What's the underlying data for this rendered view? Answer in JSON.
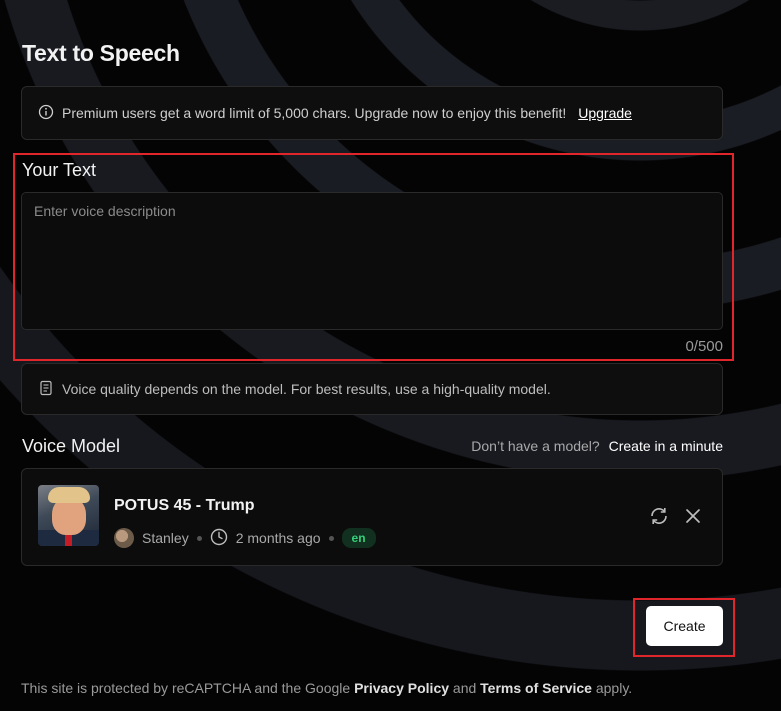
{
  "page": {
    "title": "Text to Speech"
  },
  "notice": {
    "icon": "info-icon",
    "message": "Premium users get a word limit of 5,000 chars. Upgrade now to enjoy this benefit!",
    "link_label": "Upgrade"
  },
  "text_input": {
    "label": "Your Text",
    "placeholder": "Enter voice description",
    "value": "",
    "counter": "0/500"
  },
  "quality_note": {
    "icon": "document-icon",
    "message": "Voice quality depends on the model. For best results, use a high-quality model."
  },
  "voice_model": {
    "label": "Voice Model",
    "cta_prefix": "Don’t have a model?",
    "cta_link": "Create in a minute",
    "selected": {
      "name": "POTUS 45 - Trump",
      "author": "Stanley",
      "time": "2 months ago",
      "language": "en"
    }
  },
  "actions": {
    "create_label": "Create"
  },
  "footer": {
    "prefix": "This site is protected by reCAPTCHA and the Google",
    "privacy": "Privacy Policy",
    "and": "and",
    "terms": "Terms of Service",
    "suffix": "apply."
  },
  "colors": {
    "highlight": "#e0262a",
    "badge_text": "#35d07a",
    "badge_bg": "#11301f"
  }
}
